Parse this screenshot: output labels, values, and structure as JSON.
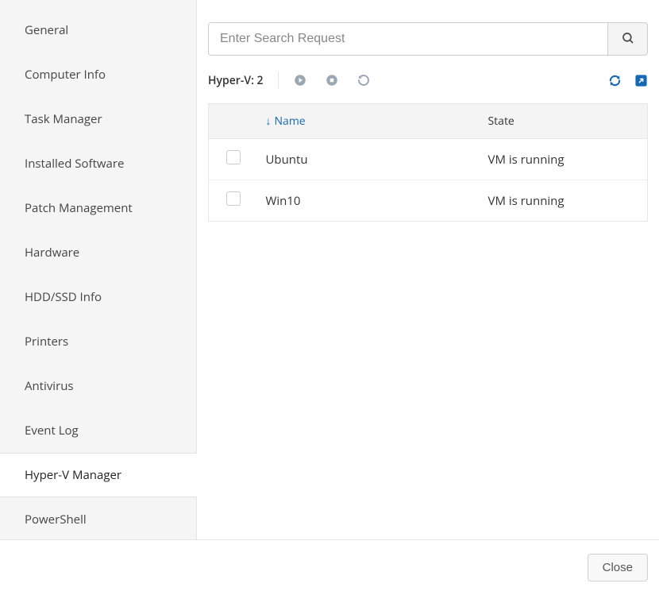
{
  "sidebar": {
    "items": [
      {
        "label": "General",
        "active": false
      },
      {
        "label": "Computer Info",
        "active": false
      },
      {
        "label": "Task Manager",
        "active": false
      },
      {
        "label": "Installed Software",
        "active": false
      },
      {
        "label": "Patch Management",
        "active": false
      },
      {
        "label": "Hardware",
        "active": false
      },
      {
        "label": "HDD/SSD Info",
        "active": false
      },
      {
        "label": "Printers",
        "active": false
      },
      {
        "label": "Antivirus",
        "active": false
      },
      {
        "label": "Event Log",
        "active": false
      },
      {
        "label": "Hyper-V Manager",
        "active": true
      },
      {
        "label": "PowerShell",
        "active": false
      }
    ]
  },
  "search": {
    "placeholder": "Enter Search Request",
    "value": ""
  },
  "toolbar": {
    "count_label": "Hyper-V: 2"
  },
  "table": {
    "columns": {
      "name": "Name",
      "state": "State"
    },
    "rows": [
      {
        "name": "Ubuntu",
        "state": "VM is running"
      },
      {
        "name": "Win10",
        "state": "VM is running"
      }
    ]
  },
  "footer": {
    "close_label": "Close"
  }
}
